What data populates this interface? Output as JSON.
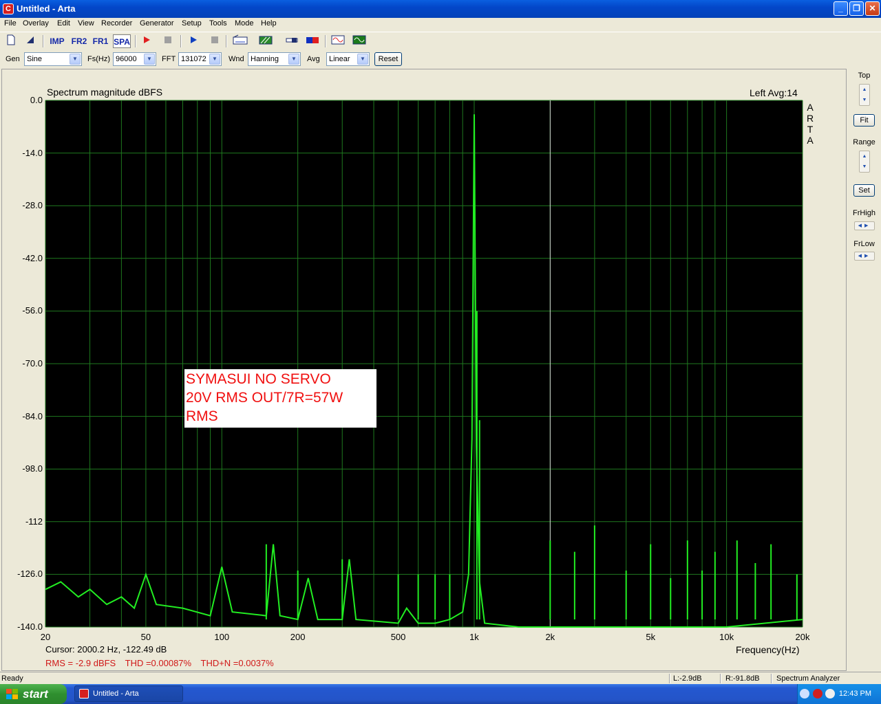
{
  "window": {
    "title": "Untitled - Arta",
    "icon_letter": "C",
    "min_glyph": "_",
    "max_glyph": "❐",
    "close_glyph": "✕"
  },
  "menu": [
    "File",
    "Overlay",
    "Edit",
    "View",
    "Recorder",
    "Generator",
    "Setup",
    "Tools",
    "Mode",
    "Help"
  ],
  "toolbar": {
    "buttons": [
      {
        "name": "new-file-icon",
        "label": ""
      },
      {
        "name": "open-file-icon",
        "label": ""
      },
      {
        "name": "imp-mode-button",
        "label": "IMP"
      },
      {
        "name": "fr2-mode-button",
        "label": "FR2"
      },
      {
        "name": "fr1-mode-button",
        "label": "FR1"
      },
      {
        "name": "spa-mode-button",
        "label": "SPA"
      }
    ],
    "accent": "#1428a8"
  },
  "genbar": {
    "gen_label": "Gen",
    "gen_value": "Sine",
    "fs_label": "Fs(Hz)",
    "fs_value": "96000",
    "fft_label": "FFT",
    "fft_value": "131072",
    "wnd_label": "Wnd",
    "wnd_value": "Hanning",
    "avg_label": "Avg",
    "avg_value": "Linear",
    "reset_label": "Reset"
  },
  "plot": {
    "title": "Spectrum magnitude dBFS",
    "channel_info": "Left  Avg:14",
    "vertical_label": "ARTA",
    "x_label": "Frequency(Hz)",
    "cursor_text": "Cursor:  2000.2 Hz, -122.49 dB",
    "rms_text": "RMS =   -2.9 dBFS",
    "thd_text": "THD =0.00087%",
    "thdn_text": "THD+N =0.0037%",
    "annotation_lines": [
      "SYMASUI NO SERVO",
      "20V RMS OUT/7R=57W",
      "RMS"
    ],
    "colors": {
      "background": "#000000",
      "grid": "#1f7a1f",
      "trace": "#22ee22",
      "cursor": "#d8d8d8",
      "annotation": "#f01010"
    }
  },
  "chart_data": {
    "type": "line",
    "title": "Spectrum magnitude dBFS",
    "xlabel": "Frequency(Hz)",
    "ylabel": "",
    "x_scale": "log",
    "xlim": [
      20,
      20000
    ],
    "ylim": [
      -140,
      0
    ],
    "y_ticks": [
      "0.0",
      "-14.0",
      "-28.0",
      "-42.0",
      "-56.0",
      "-70.0",
      "-84.0",
      "-98.0",
      "-112",
      "-126.0",
      "-140.0"
    ],
    "x_ticks": [
      "20",
      "50",
      "100",
      "200",
      "500",
      "1k",
      "2k",
      "5k",
      "10k",
      "20k"
    ],
    "cursor_hz": 2000.2,
    "grid": true,
    "series": [
      {
        "name": "Left",
        "points": [
          [
            20,
            -130
          ],
          [
            23,
            -128
          ],
          [
            27,
            -132
          ],
          [
            30,
            -130
          ],
          [
            35,
            -134
          ],
          [
            40,
            -132
          ],
          [
            45,
            -135
          ],
          [
            50,
            -126
          ],
          [
            55,
            -134
          ],
          [
            70,
            -135
          ],
          [
            90,
            -137
          ],
          [
            100,
            -124
          ],
          [
            110,
            -136
          ],
          [
            150,
            -137
          ],
          [
            160,
            -118
          ],
          [
            170,
            -137
          ],
          [
            200,
            -138
          ],
          [
            220,
            -127
          ],
          [
            240,
            -138
          ],
          [
            300,
            -138
          ],
          [
            320,
            -122
          ],
          [
            340,
            -138
          ],
          [
            500,
            -139
          ],
          [
            540,
            -135
          ],
          [
            600,
            -139
          ],
          [
            700,
            -139
          ],
          [
            800,
            -138
          ],
          [
            900,
            -136
          ],
          [
            950,
            -126
          ],
          [
            980,
            -90
          ],
          [
            1000,
            -3.7
          ],
          [
            1020,
            -92
          ],
          [
            1050,
            -128
          ],
          [
            1100,
            -139
          ],
          [
            1500,
            -140
          ],
          [
            1700,
            -140
          ],
          [
            2000,
            -140
          ],
          [
            3000,
            -140
          ],
          [
            5000,
            -140
          ],
          [
            10000,
            -140
          ],
          [
            20000,
            -138
          ]
        ],
        "harmonics": [
          [
            150,
            -118
          ],
          [
            200,
            -125
          ],
          [
            300,
            -122
          ],
          [
            500,
            -126
          ],
          [
            600,
            -126
          ],
          [
            700,
            -126
          ],
          [
            800,
            -126
          ],
          [
            1025,
            -56
          ],
          [
            1050,
            -85
          ],
          [
            2000,
            -117
          ],
          [
            2500,
            -120
          ],
          [
            3000,
            -113
          ],
          [
            4000,
            -125
          ],
          [
            5000,
            -118
          ],
          [
            6000,
            -127
          ],
          [
            7000,
            -117
          ],
          [
            8000,
            -125
          ],
          [
            9000,
            -120
          ],
          [
            11000,
            -117
          ],
          [
            13000,
            -123
          ],
          [
            15000,
            -118
          ],
          [
            19000,
            -126
          ]
        ]
      }
    ]
  },
  "side": {
    "top_label": "Top",
    "fit_label": "Fit",
    "range_label": "Range",
    "set_label": "Set",
    "frhigh_label": "FrHigh",
    "frlow_label": "FrLow"
  },
  "status": {
    "ready": "Ready",
    "left_level": "L:-2.9dB",
    "right_level": "R:-91.8dB",
    "mode": "Spectrum Analyzer"
  },
  "taskbar": {
    "start_label": "start",
    "task_label": "Untitled - Arta",
    "clock": "12:43 PM"
  }
}
